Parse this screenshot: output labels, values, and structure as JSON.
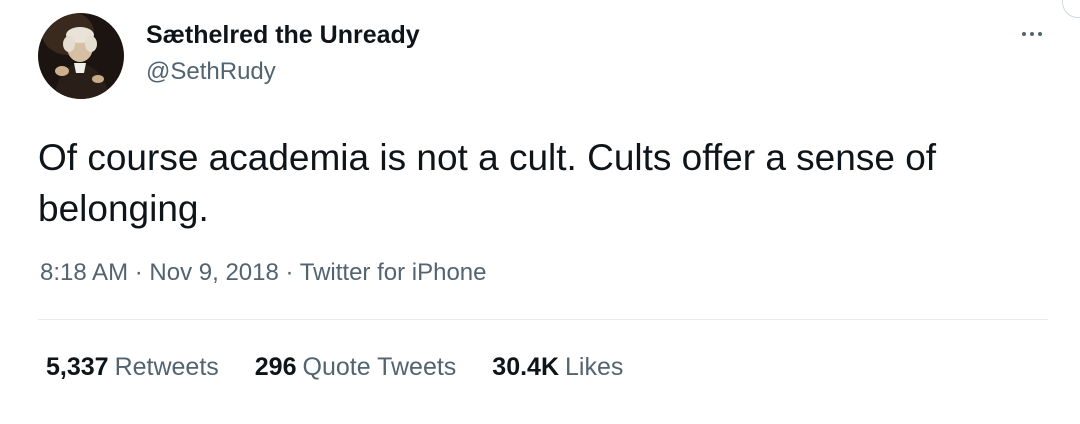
{
  "author": {
    "display_name": "Sæthelred the Unready",
    "handle": "@SethRudy",
    "avatar_icon": "portrait-avatar"
  },
  "menu": {
    "icon": "more-dots-icon"
  },
  "tweet": {
    "text": "Of course academia is not a cult. Cults offer a sense of belonging."
  },
  "meta": {
    "time": "8:18 AM",
    "separator": "·",
    "date": "Nov 9, 2018",
    "source": "Twitter for iPhone"
  },
  "stats": {
    "retweets": {
      "count": "5,337",
      "label": "Retweets"
    },
    "quotes": {
      "count": "296",
      "label": "Quote Tweets"
    },
    "likes": {
      "count": "30.4K",
      "label": "Likes"
    }
  },
  "colors": {
    "primary_text": "#0f1419",
    "secondary_text": "#536471",
    "divider": "#e6ecf0",
    "background": "#ffffff"
  }
}
